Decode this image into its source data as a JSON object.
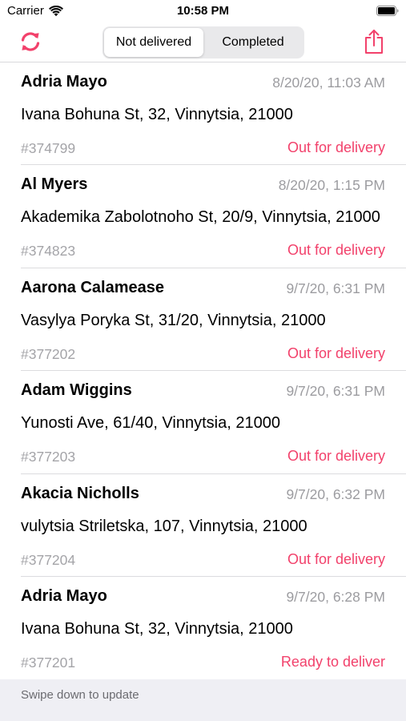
{
  "status_bar": {
    "carrier": "Carrier",
    "time": "10:58 PM"
  },
  "nav": {
    "segments": [
      "Not delivered",
      "Completed"
    ],
    "selected_segment": "Not delivered",
    "refresh_icon": "refresh-icon",
    "share_icon": "share-icon"
  },
  "colors": {
    "accent": "#f2416b",
    "status": "#f2416b",
    "secondary_text": "#9c9ca0"
  },
  "orders": [
    {
      "name": "Adria Mayo",
      "date": "8/20/20, 11:03 AM",
      "address": "Ivana Bohuna St, 32, Vinnytsia, 21000",
      "id": "#374799",
      "status": "Out for delivery"
    },
    {
      "name": "Al Myers",
      "date": "8/20/20, 1:15 PM",
      "address": "Akademika Zabolotnoho St, 20/9, Vinnytsia, 21000",
      "id": "#374823",
      "status": "Out for delivery"
    },
    {
      "name": "Aarona Calamease",
      "date": "9/7/20, 6:31 PM",
      "address": "Vasylya Poryka St, 31/20, Vinnytsia, 21000",
      "id": "#377202",
      "status": "Out for delivery"
    },
    {
      "name": "Adam Wiggins",
      "date": "9/7/20, 6:31 PM",
      "address": "Yunosti Ave, 61/40, Vinnytsia, 21000",
      "id": "#377203",
      "status": "Out for delivery"
    },
    {
      "name": "Akacia Nicholls",
      "date": "9/7/20, 6:32 PM",
      "address": "vulytsia Striletska, 107, Vinnytsia, 21000",
      "id": "#377204",
      "status": "Out for delivery"
    },
    {
      "name": "Adria Mayo",
      "date": "9/7/20, 6:28 PM",
      "address": "Ivana Bohuna St, 32, Vinnytsia, 21000",
      "id": "#377201",
      "status": "Ready to deliver"
    }
  ],
  "footer": {
    "text": "Swipe down to update"
  }
}
